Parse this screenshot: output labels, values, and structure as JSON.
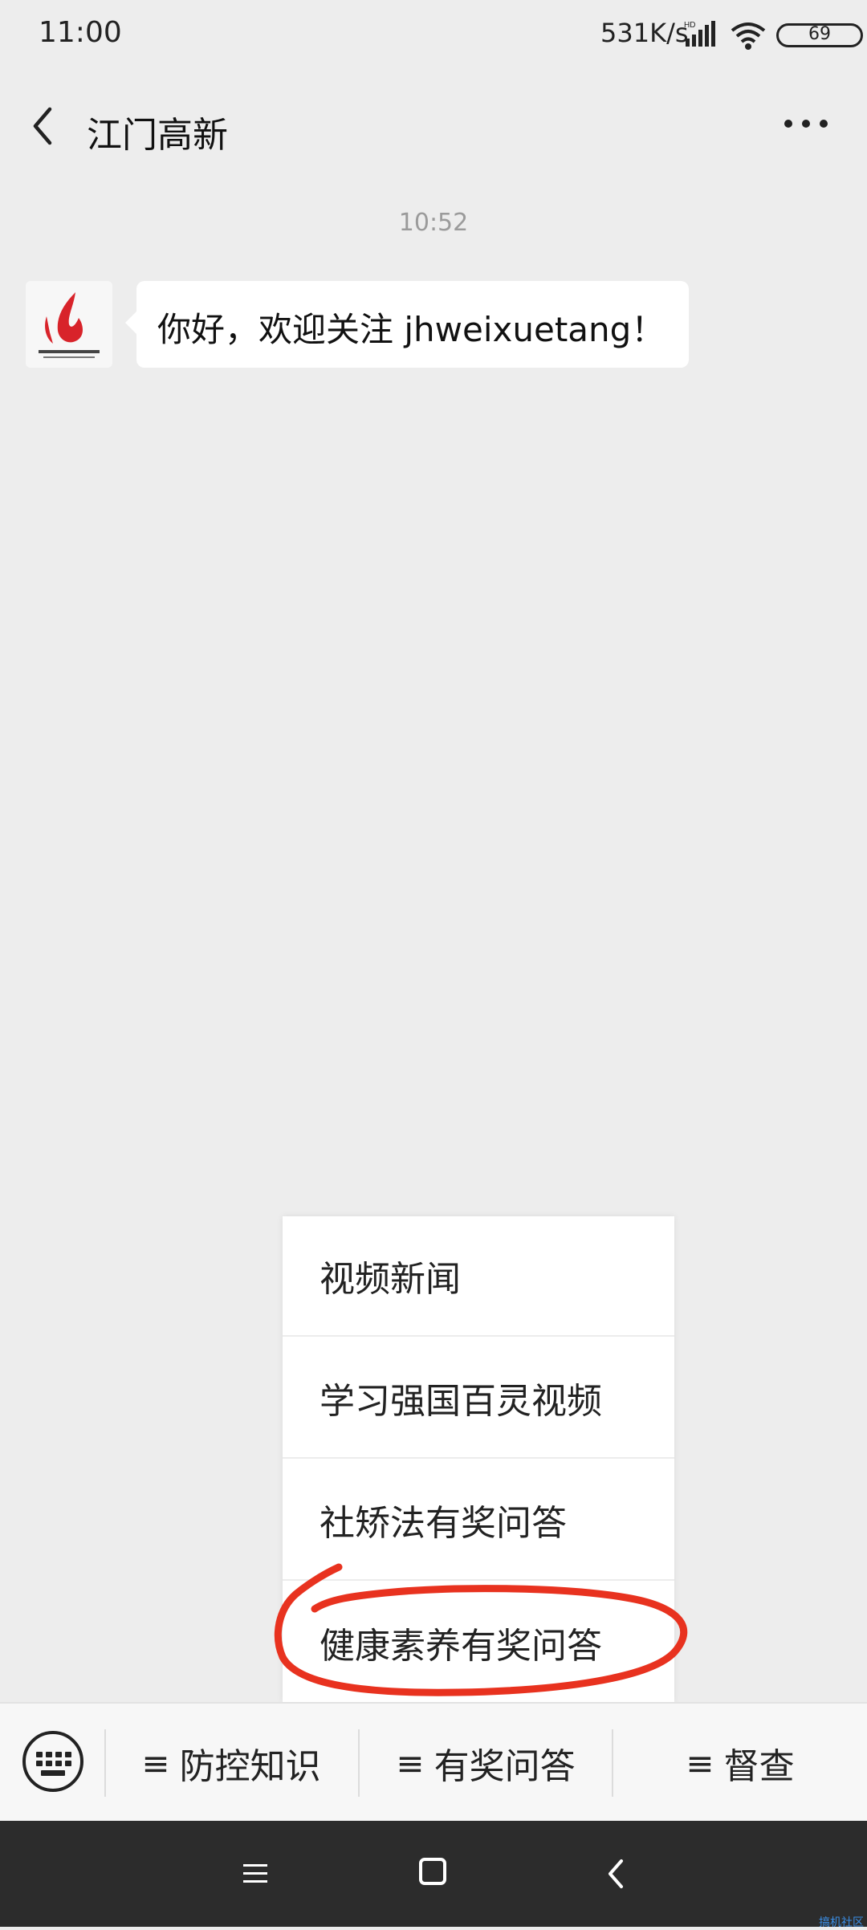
{
  "status_bar": {
    "time": "11:00",
    "net_speed": "531K/s",
    "signal_label": "HD",
    "battery": "69"
  },
  "header": {
    "title": "江门高新"
  },
  "chat": {
    "timestamp": "10:52",
    "message": "你好，欢迎关注 jhweixuetang！"
  },
  "popup_menu": {
    "items": [
      {
        "label": "视频新闻"
      },
      {
        "label": "学习强国百灵视频"
      },
      {
        "label": "社矫法有奖问答"
      },
      {
        "label": "健康素养有奖问答"
      }
    ]
  },
  "bottom_menu": {
    "tab_mark": "≡",
    "tabs": [
      {
        "label": "防控知识"
      },
      {
        "label": "有奖问答"
      },
      {
        "label": "督查"
      }
    ]
  },
  "annotation": {
    "color": "#e8321f"
  },
  "watermark": "搞机社区"
}
